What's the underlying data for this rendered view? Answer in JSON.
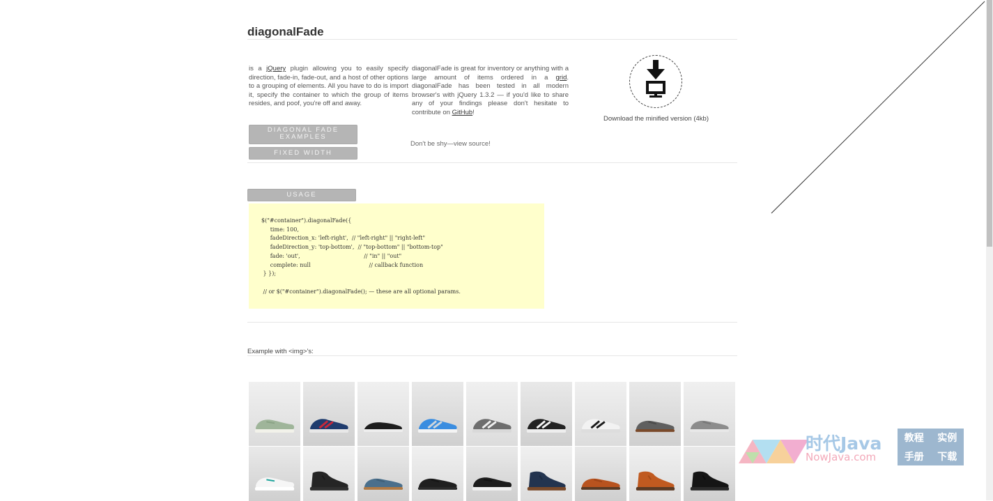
{
  "header": {
    "title": "diagonalFade"
  },
  "intro": {
    "col1": {
      "pre": "is a ",
      "link": "jQuery",
      "post": " plugin allowing you to easily specify direction, fade-in, fade-out, and a host of other options to a grouping of elements. All you have to do is import it, specify the container to which the group of items resides, and poof, you're off and away."
    },
    "col2": {
      "pre": "diagonalFade is great for inventory or anything with a large amount of items ordered in a ",
      "link1": "grid",
      "mid": ". diagonalFade has been tested in all modern browser's with jQuery 1.3.2 — if you'd like to share any of your findings please don't hesitate to contribute on ",
      "link2": "GitHub",
      "post": "!"
    }
  },
  "download": {
    "label": "Download the minified version (4kb)",
    "icon": "download-to-computer-icon"
  },
  "buttons": {
    "examples": "DIAGONAL FADE EXAMPLES",
    "fixed_width": "FIXED WIDTH",
    "usage": "USAGE"
  },
  "view_source": "Don't be shy—view source!",
  "usage_code": "$(\"#container\").diagonalFade({\n     time: 100,\n     fadeDirection_x: 'left-right',  // \"left-right\" || \"right-left\"\n     fadeDirection_y: 'top-bottom',  // \"top-bottom\" || \"bottom-top\"\n     fade: 'out',                                    // \"in\" || \"out\"\n     complete: null                                 // callback function\n } });\n\n // or $(\"#container\").diagonalFade(); — these are all optional params.",
  "example_heading": "Example with <img>'s:",
  "shoes": [
    {
      "name": "sage canvas sneaker",
      "color": "#9fb59a",
      "sole": "#f2f2ea",
      "accent": "#8aa385",
      "type": "sneaker"
    },
    {
      "name": "navy red runner",
      "color": "#1f3c6e",
      "sole": "#e8e8e8",
      "accent": "#c8283a",
      "type": "runner"
    },
    {
      "name": "black slip-on",
      "color": "#1d1d1d",
      "sole": "#eeeeee",
      "accent": "#2c2c2c",
      "type": "slipon"
    },
    {
      "name": "blue mesh trainer",
      "color": "#3a8de0",
      "sole": "#f4f4f4",
      "accent": "#cfd6dc",
      "type": "runner"
    },
    {
      "name": "grey stripe runner",
      "color": "#6e6e6e",
      "sole": "#d9d9d9",
      "accent": "#f0f0f0",
      "type": "runner"
    },
    {
      "name": "black white runner",
      "color": "#222222",
      "sole": "#eeeeee",
      "accent": "#f5f5f5",
      "type": "runner"
    },
    {
      "name": "white black runner",
      "color": "#f2f2f2",
      "sole": "#dddddd",
      "accent": "#1a1a1a",
      "type": "runner"
    },
    {
      "name": "grey derby",
      "color": "#5f5f5f",
      "sole": "#7a4a2a",
      "accent": "#4a4a4a",
      "type": "derby"
    },
    {
      "name": "grey boat shoe",
      "color": "#8c8c8c",
      "sole": "#e8e8e8",
      "accent": "#777777",
      "type": "derby"
    },
    {
      "name": "white plimsoll",
      "color": "#f6f6f6",
      "sole": "#ffffff",
      "accent": "#1aa39a",
      "type": "sneaker"
    },
    {
      "name": "black chukka",
      "color": "#252525",
      "sole": "#303030",
      "accent": "#1c1c1c",
      "type": "boot"
    },
    {
      "name": "blue suede derby",
      "color": "#4a6f8c",
      "sole": "#b07a45",
      "accent": "#3e5f78",
      "type": "derby"
    },
    {
      "name": "black leather derby",
      "color": "#1f1f1f",
      "sole": "#2a2a2a",
      "accent": "#151515",
      "type": "derby"
    },
    {
      "name": "black sneaker",
      "color": "#1c1c1c",
      "sole": "#f0f0f0",
      "accent": "#111111",
      "type": "sneaker"
    },
    {
      "name": "navy chukka",
      "color": "#23344f",
      "sole": "#7a4a2a",
      "accent": "#1c2a40",
      "type": "boot"
    },
    {
      "name": "tan oxford",
      "color": "#b8531f",
      "sole": "#5a3a24",
      "accent": "#9e4418",
      "type": "derby"
    },
    {
      "name": "tan chukka",
      "color": "#c05a20",
      "sole": "#5a3a24",
      "accent": "#a54b17",
      "type": "boot"
    },
    {
      "name": "black suede boot",
      "color": "#151515",
      "sole": "#2a2a2a",
      "accent": "#0d0d0d",
      "type": "boot"
    }
  ],
  "watermark": {
    "brand_cn": "时代Java",
    "brand_en": "NowJava.com",
    "menu": [
      "教程",
      "实例",
      "手册",
      "下载"
    ]
  }
}
